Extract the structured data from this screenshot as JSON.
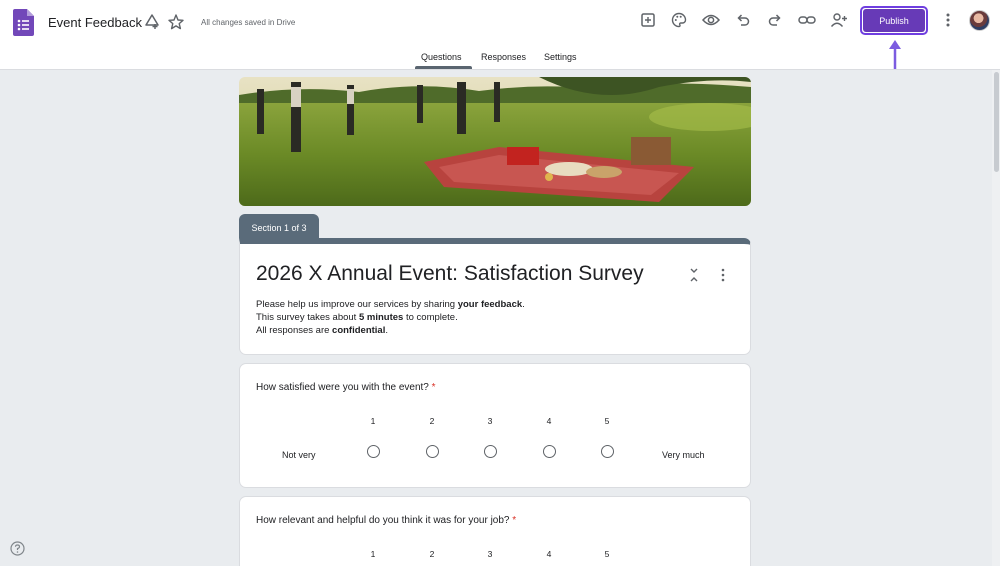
{
  "header": {
    "doc_title": "Event Feedback",
    "save_status": "All changes saved in Drive",
    "publish_label": "Publish",
    "brand_color": "#673ab7"
  },
  "icons": [
    "forms-logo-icon",
    "move-to-folder-icon",
    "star-icon",
    "addons-icon",
    "palette-icon",
    "preview-eye-icon",
    "undo-icon",
    "redo-icon",
    "link-icon",
    "add-collaborator-icon",
    "more-vert-icon",
    "avatar",
    "help-icon"
  ],
  "tabs": [
    {
      "label": "Questions",
      "active": true
    },
    {
      "label": "Responses",
      "active": false
    },
    {
      "label": "Settings",
      "active": false
    }
  ],
  "section": {
    "label": "Section 1 of 3"
  },
  "form": {
    "title": "2026 X Annual Event: Satisfaction Survey",
    "desc1_pre": "Please help us improve our services by sharing ",
    "desc1_bold": "your feedback",
    "desc1_post": ".",
    "desc2_pre": "This survey takes about ",
    "desc2_bold": "5 minutes",
    "desc2_post": " to complete.",
    "desc3_pre": "All responses are ",
    "desc3_bold": "confidential",
    "desc3_post": "."
  },
  "questions": [
    {
      "text": "How satisfied were you with the event?",
      "required_mark": "*",
      "scale": [
        "1",
        "2",
        "3",
        "4",
        "5"
      ],
      "low_label": "Not very",
      "high_label": "Very much"
    },
    {
      "text": "How relevant and helpful do you think it was for your job?",
      "required_mark": "*",
      "scale": [
        "1",
        "2",
        "3",
        "4",
        "5"
      ]
    }
  ]
}
